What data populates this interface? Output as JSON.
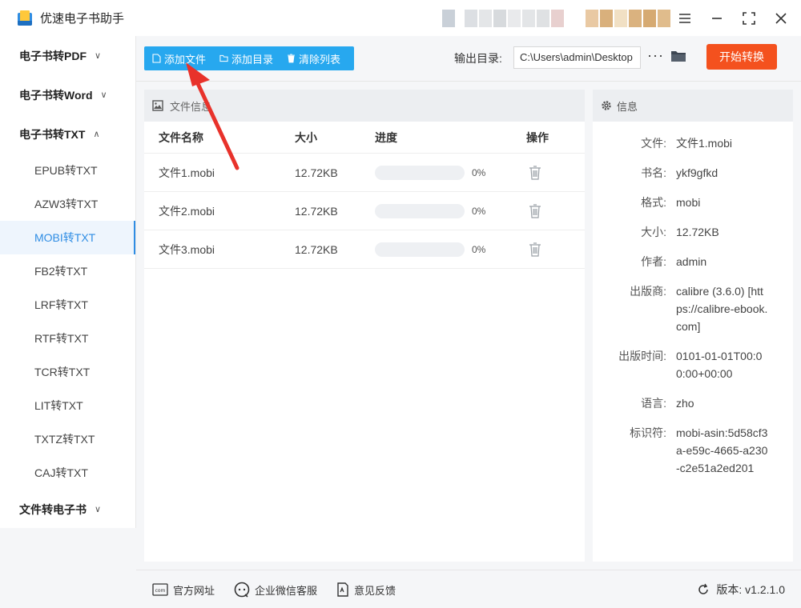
{
  "app": {
    "title": "优速电子书助手"
  },
  "sidebar": {
    "groups": [
      {
        "label": "电子书转PDF",
        "expanded": false
      },
      {
        "label": "电子书转Word",
        "expanded": false
      },
      {
        "label": "电子书转TXT",
        "expanded": true,
        "items": [
          "EPUB转TXT",
          "AZW3转TXT",
          "MOBI转TXT",
          "FB2转TXT",
          "LRF转TXT",
          "RTF转TXT",
          "TCR转TXT",
          "LIT转TXT",
          "TXTZ转TXT",
          "CAJ转TXT"
        ],
        "active_item": "MOBI转TXT"
      },
      {
        "label": "文件转电子书",
        "expanded": false
      }
    ]
  },
  "toolbar": {
    "add_file": "添加文件",
    "add_dir": "添加目录",
    "clear_list": "清除列表",
    "output_label": "输出目录:",
    "output_value": "C:\\Users\\admin\\Desktop",
    "more": "···",
    "start": "开始转换"
  },
  "file_panel": {
    "title": "文件信息",
    "columns": {
      "name": "文件名称",
      "size": "大小",
      "progress": "进度",
      "action": "操作"
    },
    "rows": [
      {
        "name": "文件1.mobi",
        "size": "12.72KB",
        "progress": 0,
        "progress_text": "0%"
      },
      {
        "name": "文件2.mobi",
        "size": "12.72KB",
        "progress": 0,
        "progress_text": "0%"
      },
      {
        "name": "文件3.mobi",
        "size": "12.72KB",
        "progress": 0,
        "progress_text": "0%"
      }
    ]
  },
  "info_panel": {
    "title": "信息",
    "fields": [
      {
        "key": "文件:",
        "value": "文件1.mobi"
      },
      {
        "key": "书名:",
        "value": "ykf9gfkd"
      },
      {
        "key": "格式:",
        "value": "mobi"
      },
      {
        "key": "大小:",
        "value": "12.72KB"
      },
      {
        "key": "作者:",
        "value": "admin"
      },
      {
        "key": "出版商:",
        "value": "calibre (3.6.0) [https://calibre-ebook.com]"
      },
      {
        "key": "出版时间:",
        "value": "0101-01-01T00:00:00+00:00"
      },
      {
        "key": "语言:",
        "value": "zho"
      },
      {
        "key": "标识符:",
        "value": "mobi-asin:5d58cf3a-e59c-4665-a230-c2e51a2ed201"
      }
    ]
  },
  "footer": {
    "website": "官方网址",
    "wechat": "企业微信客服",
    "feedback": "意见反馈",
    "version_label": "版本:",
    "version": "v1.2.1.0"
  },
  "colors": {
    "accent": "#27a8ef",
    "start": "#f4511e",
    "annotation": "#e8322b"
  }
}
